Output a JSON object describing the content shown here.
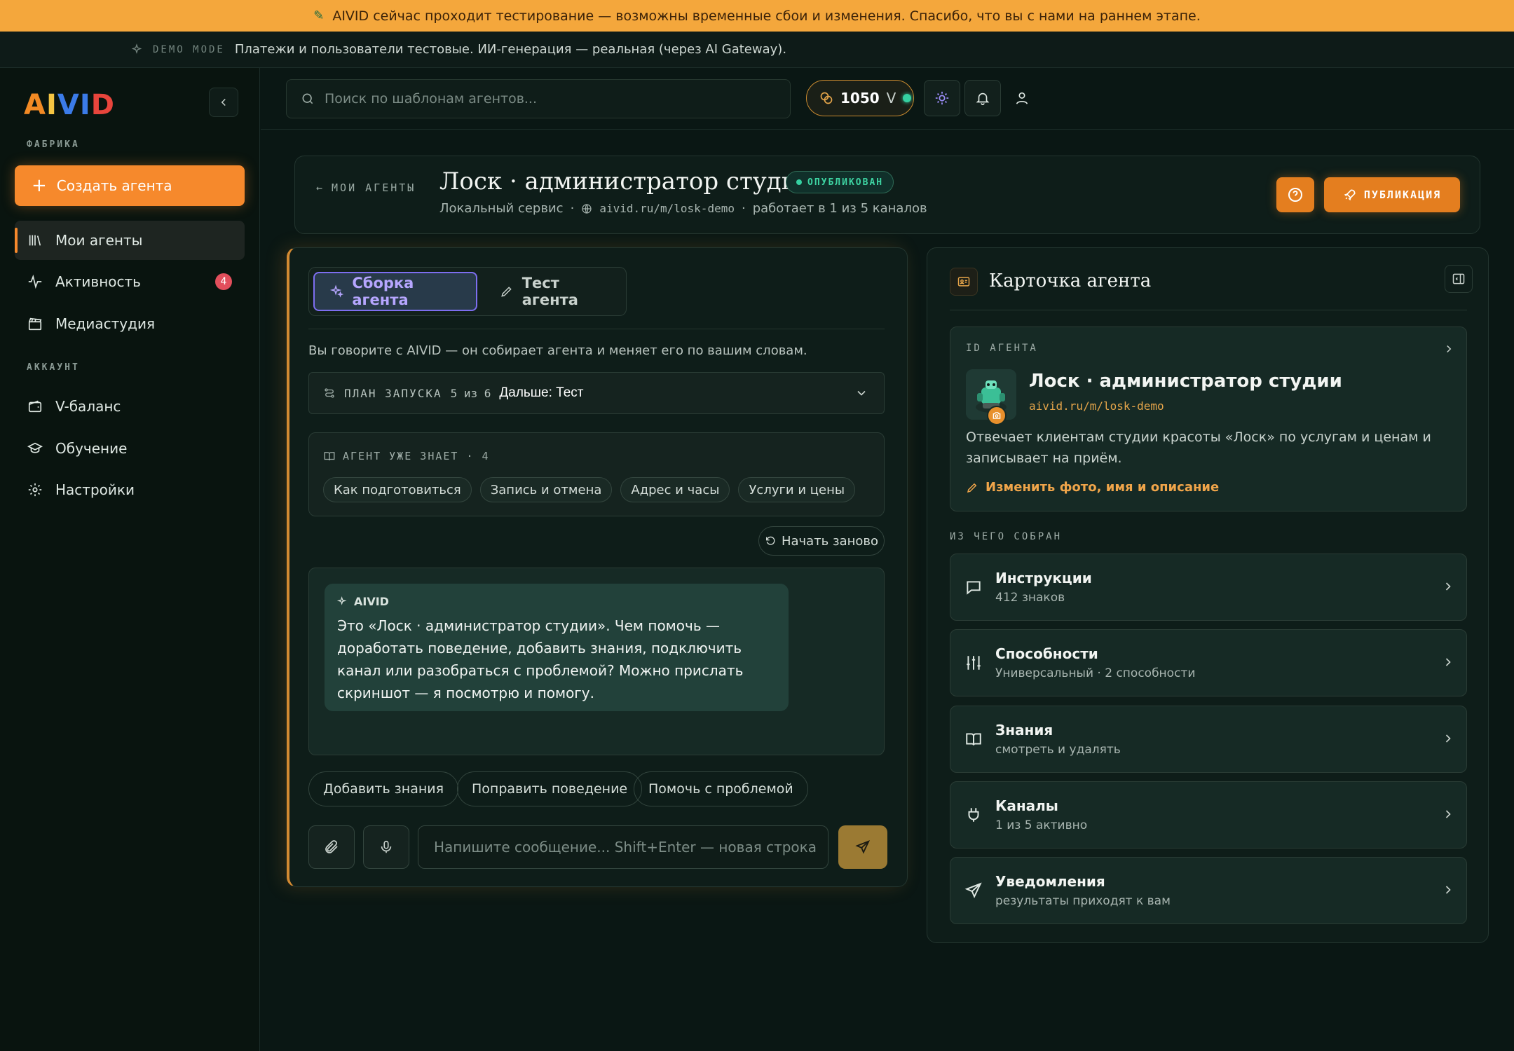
{
  "banner": {
    "text": "AIVID сейчас проходит тестирование — возможны временные сбои и изменения. Спасибо, что вы с нами на раннем этапе."
  },
  "demo": {
    "tag": "DEMO MODE",
    "text": "Платежи и пользователи тестовые. ИИ-генерация — реальная (через AI Gateway)."
  },
  "sidebar": {
    "logo": "AIVID",
    "factory_label": "ФАБРИКА",
    "create_label": "Создать агента",
    "items": [
      {
        "label": "Мои агенты"
      },
      {
        "label": "Активность",
        "badge": "4"
      },
      {
        "label": "Медиастудия"
      }
    ],
    "account_label": "АККАУНТ",
    "account_items": [
      {
        "label": "V-баланс"
      },
      {
        "label": "Обучение"
      },
      {
        "label": "Настройки"
      }
    ]
  },
  "topbar": {
    "search_placeholder": "Поиск по шаблонам агентов...",
    "balance": "1050",
    "balance_unit": "V"
  },
  "header": {
    "back_label": "МОИ АГЕНТЫ",
    "title": "Лоск · администратор студии",
    "status": "ОПУБЛИКОВАН",
    "service": "Локальный сервис",
    "url": "aivid.ru/m/losk-demo",
    "channels": "работает в 1 из 5 каналов",
    "publish_label": "ПУБЛИКАЦИЯ"
  },
  "builder": {
    "tab_build": "Сборка агента",
    "tab_test": "Тест агента",
    "intro": "Вы говорите с AIVID — он собирает агента и меняет его по вашим словам.",
    "plan_label": "ПЛАН ЗАПУСКА",
    "plan_progress": "5 из 6",
    "plan_next": "Дальше: Тест",
    "knows_label": "АГЕНТ УЖЕ ЗНАЕТ · 4",
    "knows_chips": [
      "Как подготовиться",
      "Запись и отмена",
      "Адрес и часы",
      "Услуги и цены"
    ],
    "restart_label": "Начать заново",
    "chat_author": "AIVID",
    "chat_message": "Это «Лоск · администратор студии». Чем помочь — доработать поведение, добавить знания, подключить канал или разобраться с проблемой? Можно прислать скриншот — я посмотрю и помогу.",
    "quick_actions": [
      "Добавить знания",
      "Поправить поведение",
      "Помочь с проблемой"
    ],
    "input_placeholder": "Напишите сообщение... Shift+Enter — новая строка"
  },
  "card": {
    "title": "Карточка агента",
    "id_label": "ID АГЕНТА",
    "name": "Лоск · администратор студии",
    "url": "aivid.ru/m/losk-demo",
    "description": "Отвечает клиентам студии красоты «Лоск» по услугам и ценам и записывает на приём.",
    "edit_label": "Изменить фото, имя и описание",
    "built_label": "ИЗ ЧЕГО СОБРАН",
    "rows": [
      {
        "title": "Инструкции",
        "sub": "412 знаков",
        "icon": "message-icon"
      },
      {
        "title": "Способности",
        "sub": "Универсальный · 2 способности",
        "icon": "sliders-icon"
      },
      {
        "title": "Знания",
        "sub": "смотреть и удалять",
        "icon": "book-icon"
      },
      {
        "title": "Каналы",
        "sub": "1 из 5 активно",
        "icon": "plug-icon"
      },
      {
        "title": "Уведомления",
        "sub": "результаты приходят к вам",
        "icon": "send-icon"
      }
    ]
  },
  "colors": {
    "accent": "#f6892c",
    "banner": "#f4a73c",
    "success": "#3ed5a3",
    "tab_active": "#7d6ef0",
    "background": "#0a1714"
  }
}
